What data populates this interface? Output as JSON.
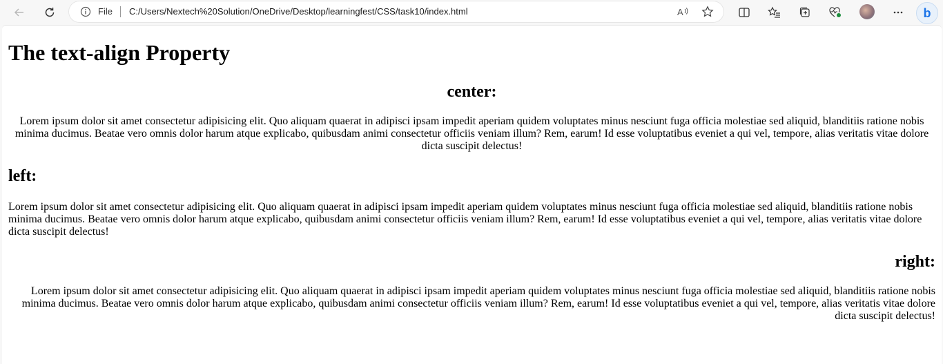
{
  "browser": {
    "address_prefix": "File",
    "url": "C:/Users/Nextech%20Solution/OneDrive/Desktop/learningfest/CSS/task10/index.html",
    "read_aloud_label": "A⁾"
  },
  "page": {
    "title": "The text-align Property",
    "sections": [
      {
        "heading": "center:",
        "text": "Lorem ipsum dolor sit amet consectetur adipisicing elit. Quo aliquam quaerat in adipisci ipsam impedit aperiam quidem voluptates minus nesciunt fuga officia molestiae sed aliquid, blanditiis ratione nobis minima ducimus. Beatae vero omnis dolor harum atque explicabo, quibusdam animi consectetur officiis veniam illum? Rem, earum! Id esse voluptatibus eveniet a qui vel, tempore, alias veritatis vitae dolore dicta suscipit delectus!"
      },
      {
        "heading": "left:",
        "text": "Lorem ipsum dolor sit amet consectetur adipisicing elit. Quo aliquam quaerat in adipisci ipsam impedit aperiam quidem voluptates minus nesciunt fuga officia molestiae sed aliquid, blanditiis ratione nobis minima ducimus. Beatae vero omnis dolor harum atque explicabo, quibusdam animi consectetur officiis veniam illum? Rem, earum! Id esse voluptatibus eveniet a qui vel, tempore, alias veritatis vitae dolore dicta suscipit delectus!"
      },
      {
        "heading": "right:",
        "text": "Lorem ipsum dolor sit amet consectetur adipisicing elit. Quo aliquam quaerat in adipisci ipsam impedit aperiam quidem voluptates minus nesciunt fuga officia molestiae sed aliquid, blanditiis ratione nobis minima ducimus. Beatae vero omnis dolor harum atque explicabo, quibusdam animi consectetur officiis veniam illum? Rem, earum! Id esse voluptatibus eveniet a qui vel, tempore, alias veritatis vitae dolore dicta suscipit delectus!"
      }
    ]
  },
  "icons": {
    "back": "back-arrow-icon",
    "refresh": "refresh-icon",
    "info": "info-icon",
    "read_aloud": "read-aloud-icon",
    "favorite": "star-icon",
    "split_screen": "split-screen-icon",
    "favorites": "favorites-list-icon",
    "collections": "collections-icon",
    "extension": "heart-pulse-icon",
    "profile": "avatar",
    "more": "more-icon",
    "copilot": "bing-icon"
  }
}
